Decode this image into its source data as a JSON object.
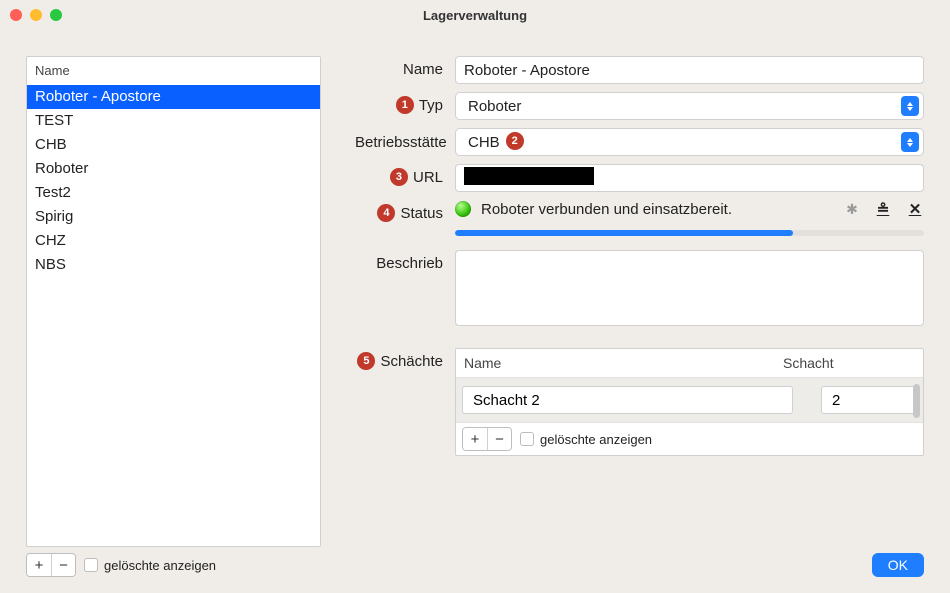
{
  "window": {
    "title": "Lagerverwaltung"
  },
  "leftList": {
    "header": "Name",
    "items": [
      "Roboter - Apostore",
      "TEST",
      "CHB",
      "Roboter",
      "Test2",
      "Spirig",
      "CHZ",
      "NBS"
    ],
    "selectedIndex": 0,
    "showDeletedLabel": "gelöschte anzeigen"
  },
  "form": {
    "name": {
      "label": "Name",
      "value": "Roboter - Apostore"
    },
    "typ": {
      "label": "Typ",
      "value": "Roboter"
    },
    "betriebsstaette": {
      "label": "Betriebsstätte",
      "value": "CHB"
    },
    "url": {
      "label": "URL",
      "value": ""
    },
    "status": {
      "label": "Status",
      "text": "Roboter verbunden und einsatzbereit.",
      "progressPercent": 72
    },
    "beschrieb": {
      "label": "Beschrieb",
      "value": ""
    },
    "schaechte": {
      "label": "Schächte",
      "columns": {
        "name": "Name",
        "schacht": "Schacht"
      },
      "rows": [
        {
          "name": "Schacht 2",
          "schacht": "2"
        }
      ],
      "showDeletedLabel": "gelöschte anzeigen"
    }
  },
  "badges": {
    "b1": "1",
    "b2": "2",
    "b3": "3",
    "b4": "4",
    "b5": "5"
  },
  "buttons": {
    "ok": "OK",
    "plus": "+",
    "minus": "−"
  }
}
